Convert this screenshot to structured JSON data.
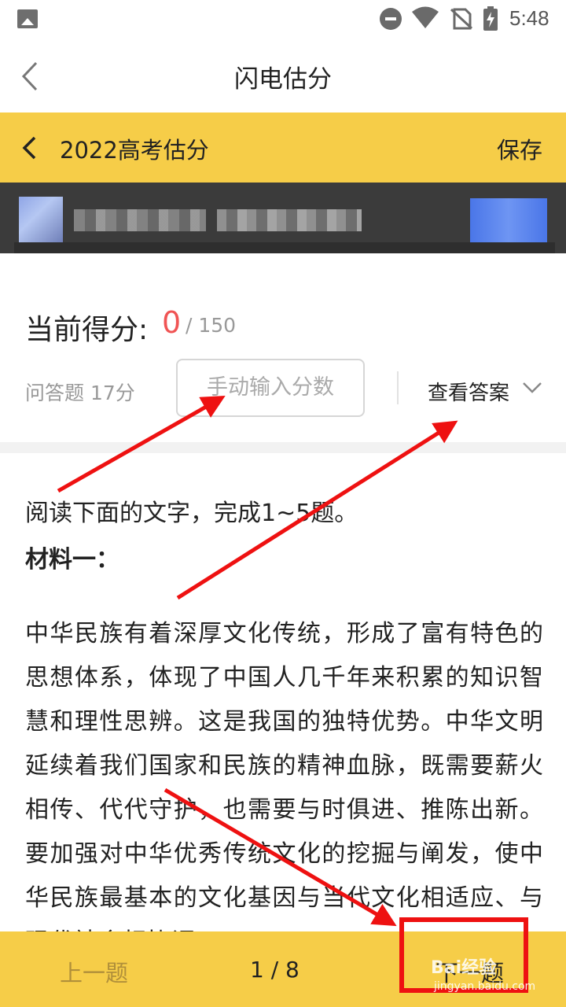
{
  "status_bar": {
    "time": "5:48",
    "icons": [
      "image-icon",
      "do-not-disturb-icon",
      "wifi-icon",
      "no-sim-icon",
      "battery-charging-icon"
    ]
  },
  "header": {
    "title": "闪电估分",
    "back_icon": "chevron-left-icon"
  },
  "subbar": {
    "title": "2022高考估分",
    "save_label": "保存",
    "back_icon": "chevron-left-icon",
    "background": "#f6cd48"
  },
  "score": {
    "label": "当前得分:",
    "value": "0",
    "total": "/ 150",
    "value_color": "#f05454"
  },
  "question": {
    "type_label": "问答题 17分",
    "manual_input_placeholder": "手动输入分数",
    "view_answer_label": "查看答案"
  },
  "passage": {
    "intro": "阅读下面的文字，完成1~5题。",
    "material_title": "材料一：",
    "paragraph": "中华民族有着深厚文化传统，形成了富有特色的思想体系，体现了中国人几千年来积累的知识智慧和理性思辨。这是我国的独特优势。中华文明延续着我们国家和民族的精神血脉，既需要薪火相传、代代守护，也需要与时俱进、推陈出新。要加强对中华优秀传统文化的挖掘与阐发，使中华民族最基本的文化基因与当代文化相适应、与现代社会相协调"
  },
  "bottom_bar": {
    "prev_label": "上一题",
    "page_current": "1",
    "page_separator": "/",
    "page_total": "8",
    "page_text": "1  /  8",
    "next_label": "下一题",
    "background": "#f6cd48"
  },
  "annotations": {
    "arrow_color": "#ee1111",
    "box_color": "#ee1111"
  },
  "watermark": {
    "logo": "Bai经验",
    "url": "jingyan.baidu.com"
  }
}
